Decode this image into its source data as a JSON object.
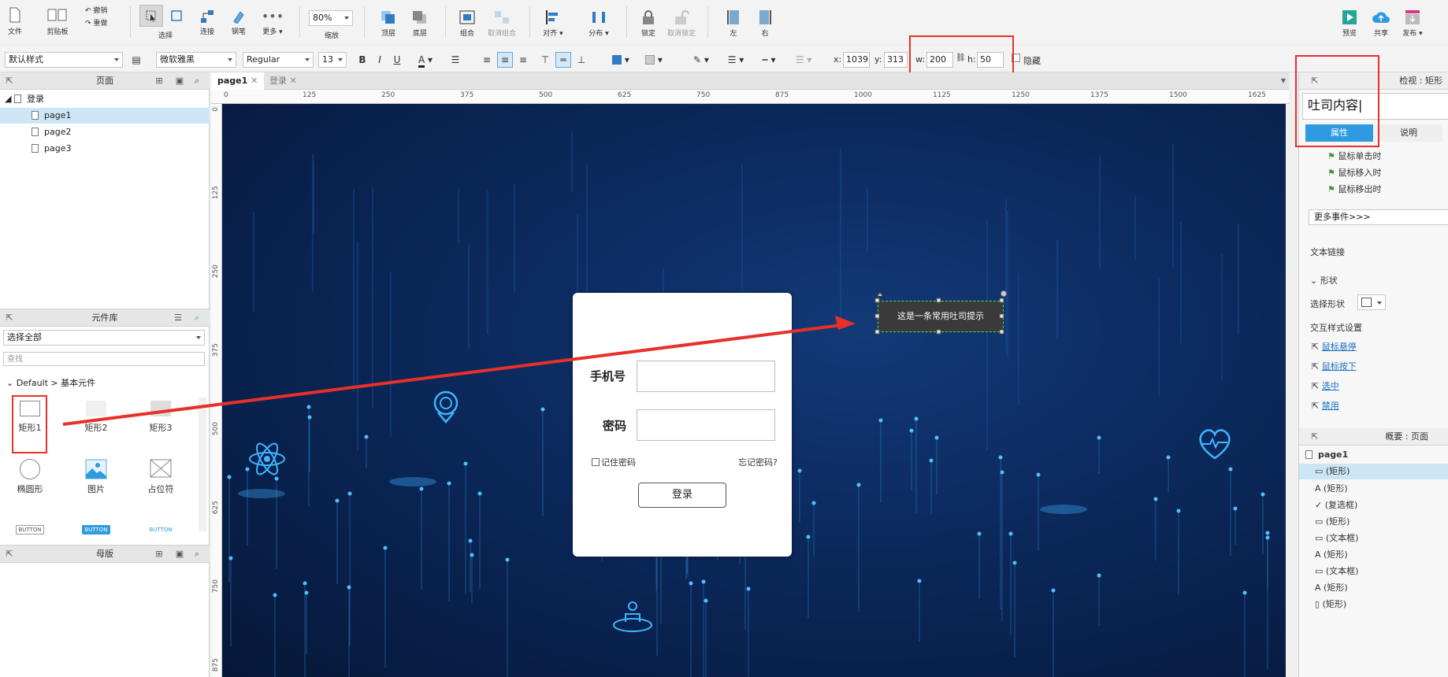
{
  "toolbar": {
    "file": "文件",
    "clipboard": "剪贴板",
    "undo": "撤销",
    "redo": "重做",
    "select": "选择",
    "connect": "连接",
    "pen": "钢笔",
    "more": "更多 ▾",
    "zoom_value": "80%",
    "zoom": "缩放",
    "top": "顶层",
    "bottom": "底层",
    "group": "组合",
    "ungroup": "取消组合",
    "align": "对齐 ▾",
    "distribute": "分布 ▾",
    "lock": "锁定",
    "unlock": "取消锁定",
    "left": "左",
    "right": "右",
    "preview": "预览",
    "share": "共享",
    "publish": "发布 ▾"
  },
  "format": {
    "style": "默认样式",
    "font": "微软雅黑",
    "weight": "Regular",
    "size": "13",
    "x_label": "x:",
    "x_value": "1039",
    "y_label": "y:",
    "y_value": "313",
    "w_label": "w:",
    "w_value": "200",
    "h_label": "h:",
    "h_value": "50",
    "hide": "隐藏"
  },
  "pages_panel": {
    "title": "页面",
    "folder": "登录",
    "pages": [
      "page1",
      "page2",
      "page3"
    ]
  },
  "library_panel": {
    "title": "元件库",
    "filter": "选择全部",
    "search_placeholder": "查找",
    "group": "Default > 基本元件",
    "widgets": [
      "矩形1",
      "矩形2",
      "矩形3",
      "椭圆形",
      "图片",
      "占位符"
    ],
    "buttons": [
      "BUTTON",
      "BUTTON",
      "BUTTON"
    ]
  },
  "masters_panel": {
    "title": "母版"
  },
  "tabs": [
    "page1",
    "登录"
  ],
  "ruler_top": [
    "0",
    "125",
    "250",
    "375",
    "500",
    "625",
    "750",
    "875",
    "1000",
    "1125",
    "1250",
    "1375",
    "1500",
    "1625"
  ],
  "ruler_left": [
    "0",
    "125",
    "250",
    "375",
    "500",
    "625",
    "750",
    "875"
  ],
  "login": {
    "phone_label": "手机号",
    "password_label": "密码",
    "remember": "记住密码",
    "forgot": "忘记密码?",
    "login_button": "登录"
  },
  "toast_text": "这是一条常用吐司提示",
  "inspector": {
    "title": "检视 : 矩形",
    "name_value": "吐司内容",
    "tab_props": "属性",
    "tab_notes": "说明",
    "events": [
      "鼠标单击时",
      "鼠标移入时",
      "鼠标移出时"
    ],
    "more_events": "更多事件>>>",
    "text_link": "文本链接",
    "shape_section": "形状",
    "select_shape": "选择形状",
    "interaction_styles": "交互样式设置",
    "style_links": [
      "鼠标悬停",
      "鼠标按下",
      "选中",
      "禁用"
    ]
  },
  "outline": {
    "title": "概要 : 页面",
    "root": "page1",
    "items": [
      "(矩形)",
      "(矩形)",
      "(复选框)",
      "(矩形)",
      "(文本框)",
      "(矩形)",
      "(文本框)",
      "(矩形)",
      "(矩形)"
    ]
  },
  "colors": {
    "accent": "#2e9be0",
    "highlight": "#e8302a",
    "canvas": "#0c2a5e"
  }
}
